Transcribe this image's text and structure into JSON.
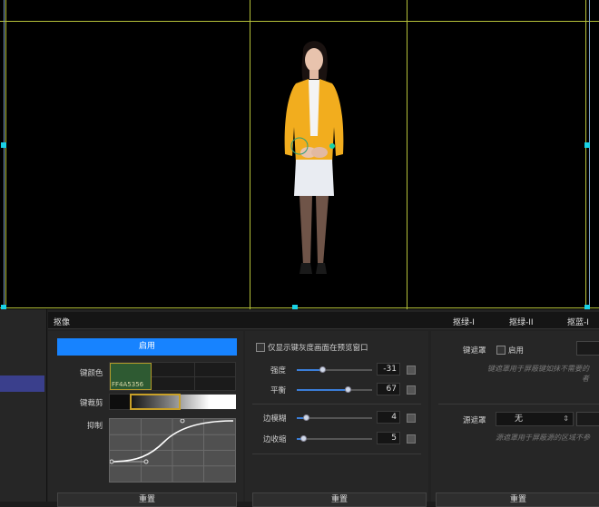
{
  "tabs": {
    "main": "抠像",
    "green1": "抠绿-I",
    "green2": "抠绿-II",
    "blue1": "抠蓝-I"
  },
  "key_panel": {
    "enable_label": "启用",
    "key_color_label": "键颜色",
    "key_color_hex": "FF4A5356",
    "key_color_swatch": "#2e5a32",
    "key_clip_label": "键裁剪",
    "suppress_label": "抑制",
    "reset_label": "重置"
  },
  "adjust_panel": {
    "gray_preview_label": "仅显示键灰度画面在预览窗口",
    "strength_label": "强度",
    "strength_value": "-31",
    "balance_label": "平衡",
    "balance_value": "67",
    "edge_blur_label": "边模糊",
    "edge_blur_value": "4",
    "edge_shrink_label": "边收缩",
    "edge_shrink_value": "5",
    "reset_label": "重置"
  },
  "mask_panel": {
    "key_mask_label": "键遮罩",
    "enable_label": "启用",
    "key_mask_hint_line1": "键遮罩用于屏蔽键如抹不需要的",
    "key_mask_hint_line2": "者",
    "source_mask_label": "源遮罩",
    "source_mask_value": "无",
    "source_mask_hint": "源遮罩用于屏蔽源的区域不参",
    "reset_label": "重置"
  },
  "colors": {
    "accent": "#1783ff",
    "guide_line": "#b6c23a",
    "handle": "#19d2e6"
  }
}
